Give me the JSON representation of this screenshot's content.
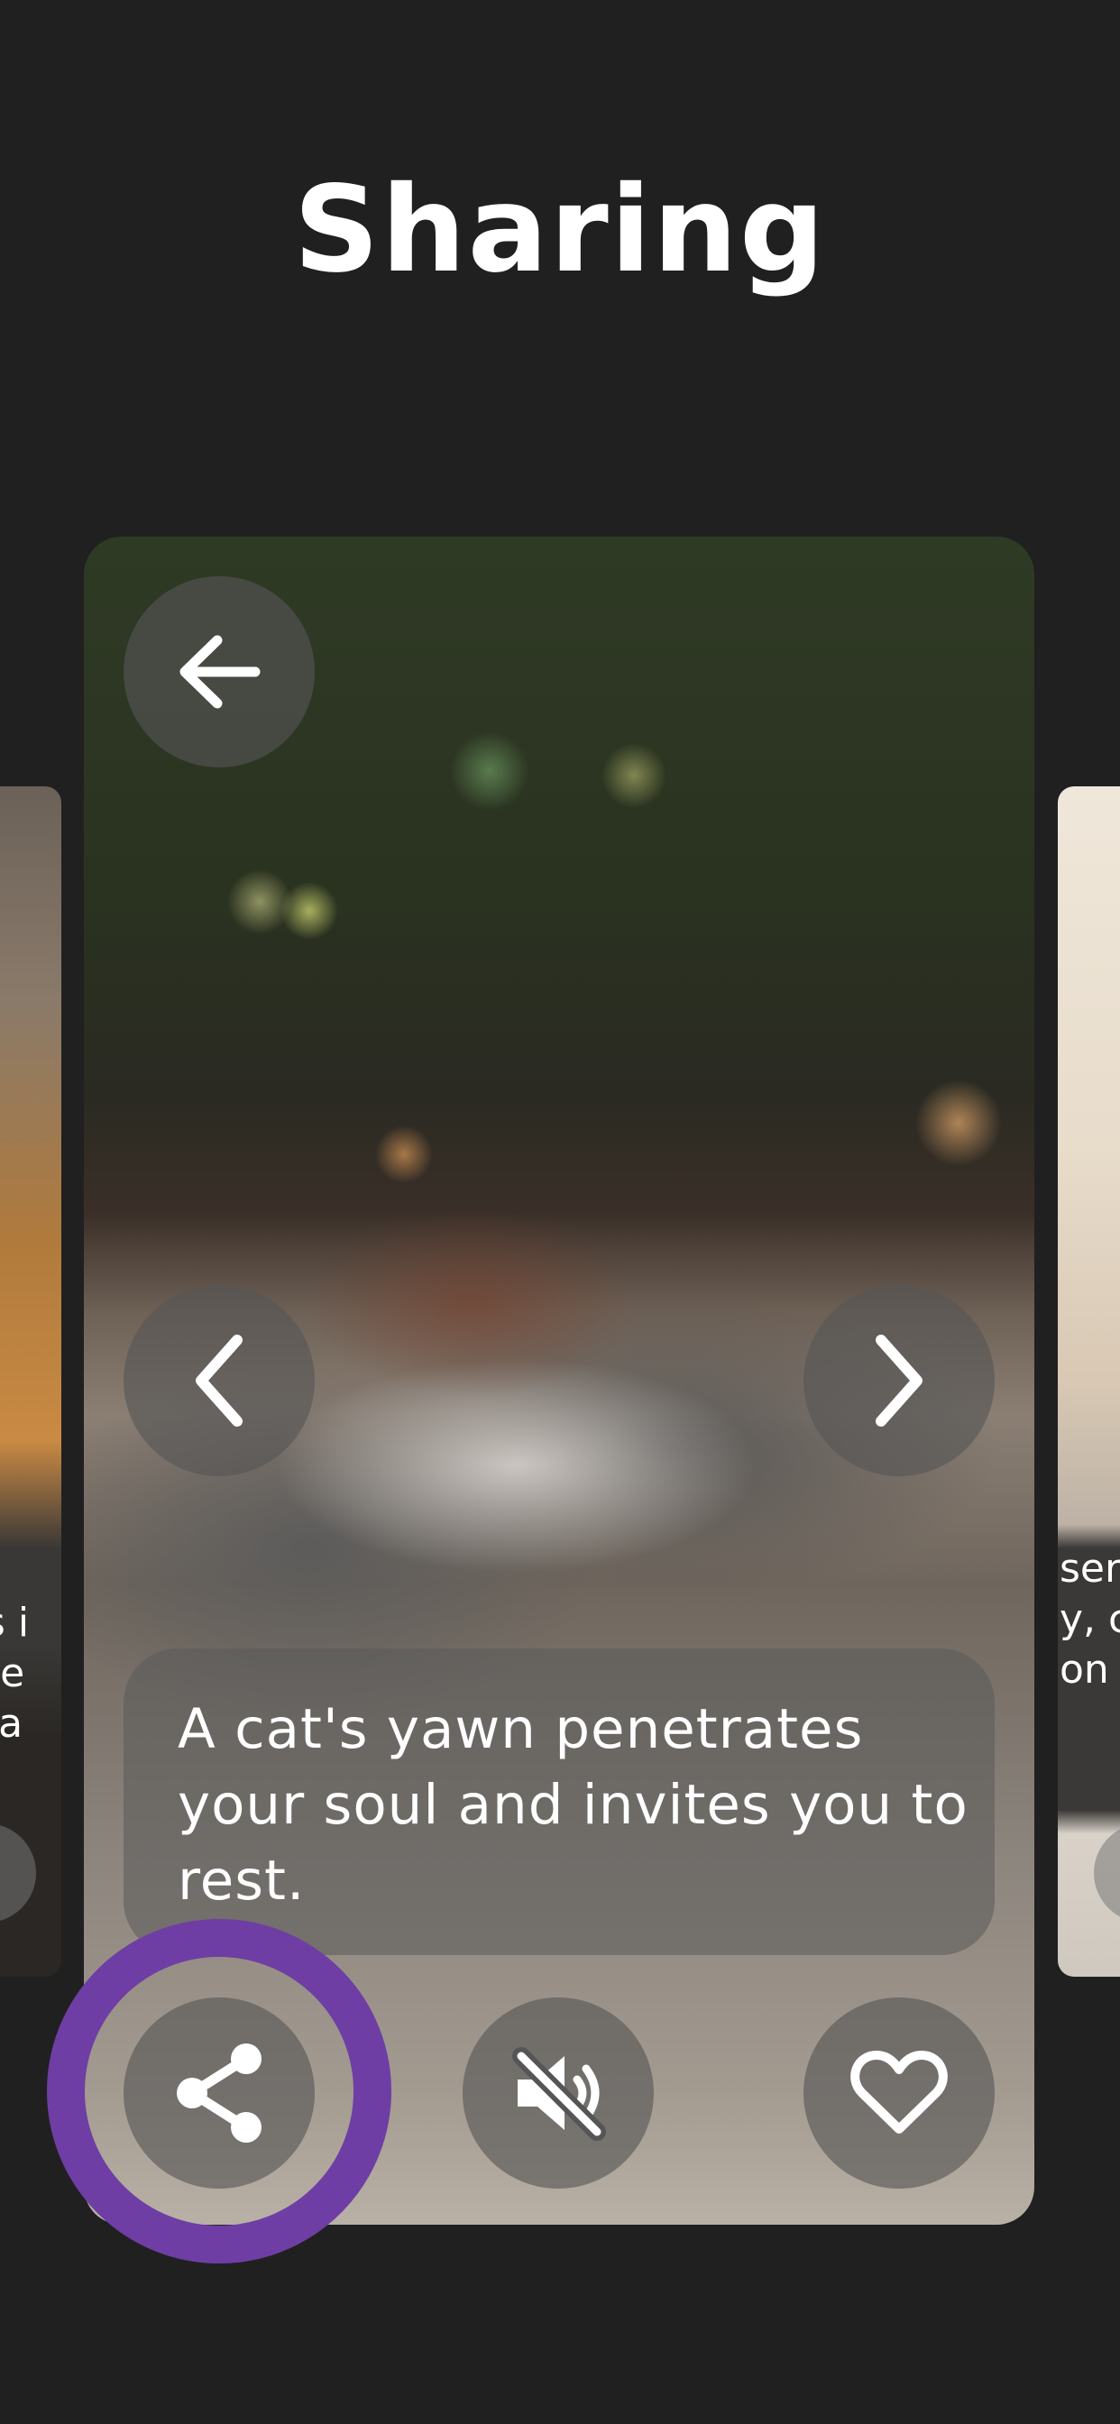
{
  "screen": {
    "title": "Sharing"
  },
  "card": {
    "caption": "A cat's yawn penetrates your soul and invites you to rest.",
    "buttons": {
      "back": "arrow-left-icon",
      "previous": "chevron-left-icon",
      "next": "chevron-right-icon",
      "share": "share-icon",
      "mute": "volume-muted-icon",
      "favorite": "heart-icon"
    }
  },
  "left_card": {
    "caption_fragment": "ss i\nine\n ca"
  },
  "right_card": {
    "caption_fragment": "ser\ny, c\non"
  },
  "highlight": {
    "color": "#6e3ea4",
    "target": "share-button"
  }
}
